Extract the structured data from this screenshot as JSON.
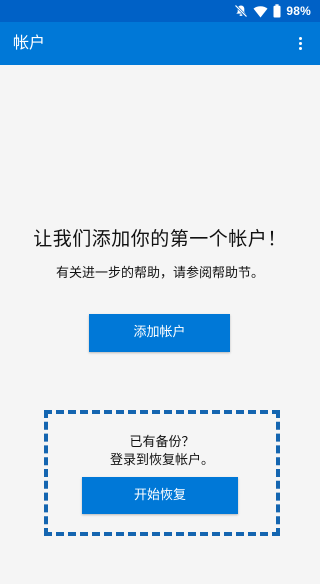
{
  "status_bar": {
    "battery_text": "98%",
    "icons": [
      "mute-icon",
      "wifi-icon",
      "battery-icon"
    ]
  },
  "app_bar": {
    "title": "帐户",
    "menu_icon": "overflow-menu-icon"
  },
  "main": {
    "headline": "让我们添加你的第一个帐户！",
    "help_text": "有关进一步的帮助，请参阅帮助节。",
    "add_account_button": "添加帐户"
  },
  "restore": {
    "line1": "已有备份？",
    "line2": "登录到恢复帐户。",
    "button": "开始恢复"
  },
  "colors": {
    "status_bar": "#0061c6",
    "app_bar": "#0078d7",
    "accent": "#0078d7",
    "dashed_border": "#1465b0",
    "background": "#f5f5f5"
  }
}
